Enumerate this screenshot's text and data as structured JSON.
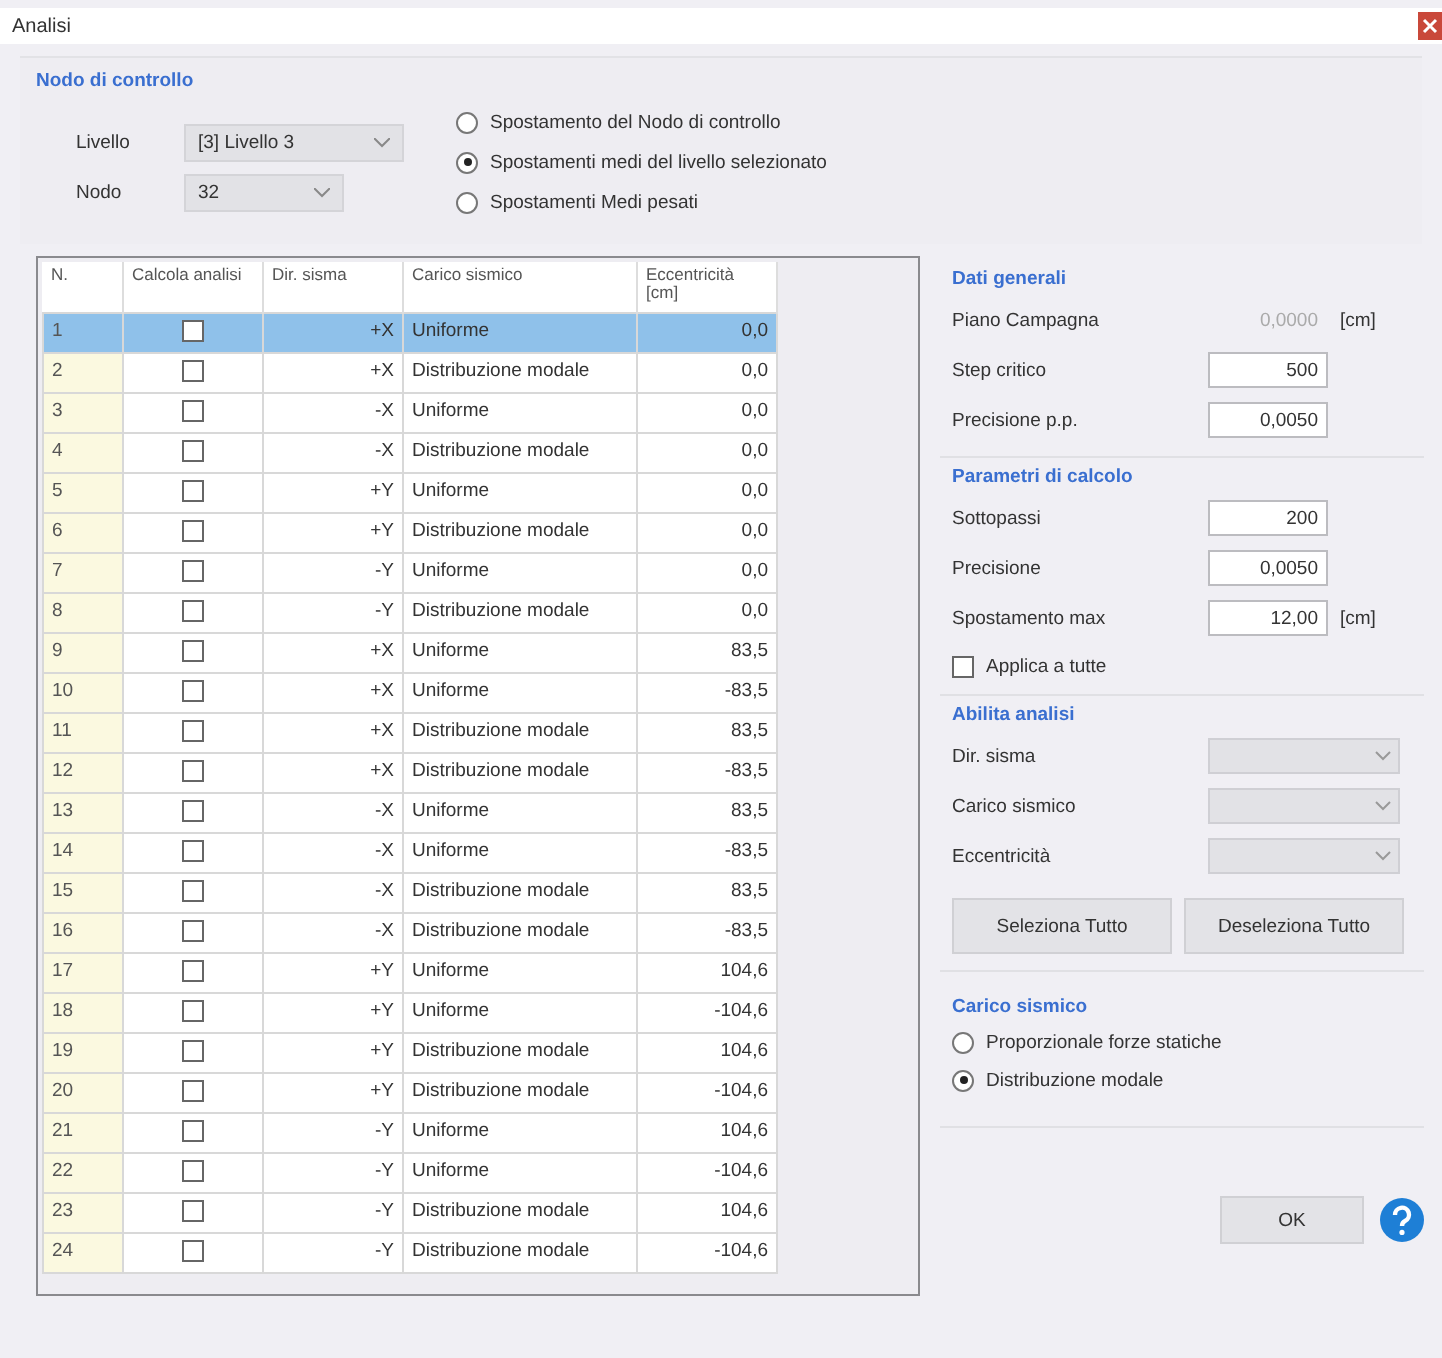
{
  "window": {
    "title": "Analisi"
  },
  "control_node": {
    "title": "Nodo di controllo",
    "fields": [
      {
        "label": "Livello",
        "value": "[3]  Livello 3"
      },
      {
        "label": "Nodo",
        "value": "32"
      }
    ],
    "modes": [
      {
        "label": "Spostamento del Nodo di controllo",
        "selected": false
      },
      {
        "label": "Spostamenti medi del livello selezionato",
        "selected": true
      },
      {
        "label": "Spostamenti Medi pesati",
        "selected": false
      }
    ]
  },
  "table": {
    "columns": [
      "N.",
      "Calcola analisi",
      "Dir. sisma",
      "Carico sismico",
      "Eccentricità [cm]"
    ],
    "rows": [
      {
        "n": "1",
        "checked": false,
        "dir": "+X",
        "load": "Uniforme",
        "ecc": "0,0",
        "selected": true
      },
      {
        "n": "2",
        "checked": false,
        "dir": "+X",
        "load": "Distribuzione modale",
        "ecc": "0,0",
        "selected": false
      },
      {
        "n": "3",
        "checked": false,
        "dir": "-X",
        "load": "Uniforme",
        "ecc": "0,0",
        "selected": false
      },
      {
        "n": "4",
        "checked": false,
        "dir": "-X",
        "load": "Distribuzione modale",
        "ecc": "0,0",
        "selected": false
      },
      {
        "n": "5",
        "checked": false,
        "dir": "+Y",
        "load": "Uniforme",
        "ecc": "0,0",
        "selected": false
      },
      {
        "n": "6",
        "checked": false,
        "dir": "+Y",
        "load": "Distribuzione modale",
        "ecc": "0,0",
        "selected": false
      },
      {
        "n": "7",
        "checked": false,
        "dir": "-Y",
        "load": "Uniforme",
        "ecc": "0,0",
        "selected": false
      },
      {
        "n": "8",
        "checked": false,
        "dir": "-Y",
        "load": "Distribuzione modale",
        "ecc": "0,0",
        "selected": false
      },
      {
        "n": "9",
        "checked": false,
        "dir": "+X",
        "load": "Uniforme",
        "ecc": "83,5",
        "selected": false
      },
      {
        "n": "10",
        "checked": false,
        "dir": "+X",
        "load": "Uniforme",
        "ecc": "-83,5",
        "selected": false
      },
      {
        "n": "11",
        "checked": false,
        "dir": "+X",
        "load": "Distribuzione modale",
        "ecc": "83,5",
        "selected": false
      },
      {
        "n": "12",
        "checked": false,
        "dir": "+X",
        "load": "Distribuzione modale",
        "ecc": "-83,5",
        "selected": false
      },
      {
        "n": "13",
        "checked": false,
        "dir": "-X",
        "load": "Uniforme",
        "ecc": "83,5",
        "selected": false
      },
      {
        "n": "14",
        "checked": false,
        "dir": "-X",
        "load": "Uniforme",
        "ecc": "-83,5",
        "selected": false
      },
      {
        "n": "15",
        "checked": false,
        "dir": "-X",
        "load": "Distribuzione modale",
        "ecc": "83,5",
        "selected": false
      },
      {
        "n": "16",
        "checked": false,
        "dir": "-X",
        "load": "Distribuzione modale",
        "ecc": "-83,5",
        "selected": false
      },
      {
        "n": "17",
        "checked": false,
        "dir": "+Y",
        "load": "Uniforme",
        "ecc": "104,6",
        "selected": false
      },
      {
        "n": "18",
        "checked": false,
        "dir": "+Y",
        "load": "Uniforme",
        "ecc": "-104,6",
        "selected": false
      },
      {
        "n": "19",
        "checked": false,
        "dir": "+Y",
        "load": "Distribuzione modale",
        "ecc": "104,6",
        "selected": false
      },
      {
        "n": "20",
        "checked": false,
        "dir": "+Y",
        "load": "Distribuzione modale",
        "ecc": "-104,6",
        "selected": false
      },
      {
        "n": "21",
        "checked": false,
        "dir": "-Y",
        "load": "Uniforme",
        "ecc": "104,6",
        "selected": false
      },
      {
        "n": "22",
        "checked": false,
        "dir": "-Y",
        "load": "Uniforme",
        "ecc": "-104,6",
        "selected": false
      },
      {
        "n": "23",
        "checked": false,
        "dir": "-Y",
        "load": "Distribuzione modale",
        "ecc": "104,6",
        "selected": false
      },
      {
        "n": "24",
        "checked": false,
        "dir": "-Y",
        "load": "Distribuzione modale",
        "ecc": "-104,6",
        "selected": false
      }
    ]
  },
  "general": {
    "title": "Dati generali",
    "fields": [
      {
        "label": "Piano Campagna",
        "value": "0,0000",
        "unit": "[cm]",
        "disabled": true
      },
      {
        "label": "Step critico",
        "value": "500",
        "disabled": false
      },
      {
        "label": "Precisione p.p.",
        "value": "0,0050",
        "disabled": false
      }
    ]
  },
  "calc": {
    "title": "Parametri di calcolo",
    "fields": [
      {
        "label": "Sottopassi",
        "value": "200"
      },
      {
        "label": "Precisione",
        "value": "0,0050"
      },
      {
        "label": "Spostamento max",
        "value": "12,00",
        "unit": "[cm]"
      }
    ],
    "apply_all": {
      "label": "Applica a tutte",
      "checked": false
    }
  },
  "enable": {
    "title": "Abilita analisi",
    "dropdowns": [
      {
        "label": "Dir. sisma"
      },
      {
        "label": "Carico sismico"
      },
      {
        "label": "Eccentricità"
      }
    ],
    "buttons": [
      "Seleziona Tutto",
      "Deseleziona Tutto"
    ]
  },
  "seismic": {
    "title": "Carico sismico",
    "options": [
      {
        "label": "Proporzionale forze statiche",
        "selected": false
      },
      {
        "label": "Distribuzione modale",
        "selected": true
      }
    ]
  },
  "ok_button": "OK"
}
